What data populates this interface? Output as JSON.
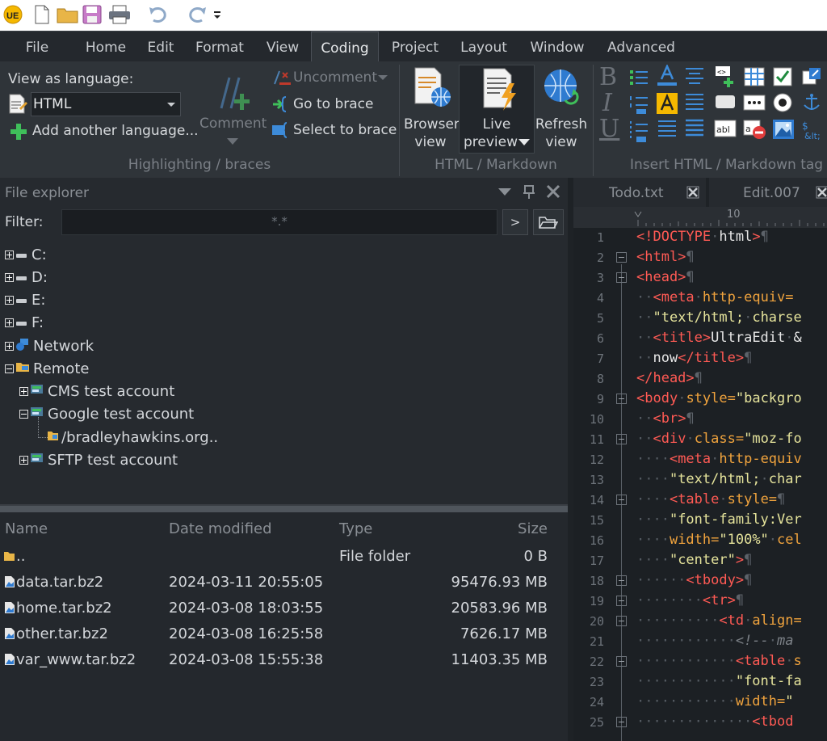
{
  "menu": {
    "tabs": [
      "File",
      "Home",
      "Edit",
      "Format",
      "View",
      "Coding",
      "Project",
      "Layout",
      "Window",
      "Advanced"
    ],
    "active": "Coding"
  },
  "ribbon": {
    "view_as_language_label": "View as language:",
    "language_value": "HTML",
    "add_language": "Add another language...",
    "comment": "Comment",
    "uncomment": "Uncomment",
    "go_to_brace": "Go to brace",
    "select_to_brace": "Select to brace",
    "group_highlighting": "Highlighting / braces",
    "browser_view": [
      "Browser",
      "view"
    ],
    "live_preview": [
      "Live",
      "preview"
    ],
    "refresh_view": [
      "Refresh",
      "view"
    ],
    "group_html": "HTML / Markdown",
    "format_letters": [
      "B",
      "I",
      "U"
    ],
    "group_insert": "Insert HTML / Markdown tag"
  },
  "explorer": {
    "title": "File explorer",
    "filter_label": "Filter:",
    "filter_value": "*.*",
    "go_button": ">",
    "tree": [
      {
        "label": "C:"
      },
      {
        "label": "D:"
      },
      {
        "label": "E:"
      },
      {
        "label": "F:"
      },
      {
        "label": "Network"
      },
      {
        "label": "Remote"
      },
      {
        "label": "CMS test account"
      },
      {
        "label": "Google test account"
      },
      {
        "label": "/bradleyhawkins.org.."
      },
      {
        "label": "SFTP test account"
      }
    ]
  },
  "files": {
    "columns": {
      "name": "Name",
      "date": "Date modified",
      "type": "Type",
      "size": "Size"
    },
    "rows": [
      {
        "name": "..",
        "date": "",
        "type": "File folder",
        "size": "0 B"
      },
      {
        "name": "data.tar.bz2",
        "date": "2024-03-11 20:55:05",
        "type": "",
        "size": "95476.93 MB"
      },
      {
        "name": "home.tar.bz2",
        "date": "2024-03-08 18:03:55",
        "type": "",
        "size": "20583.96 MB"
      },
      {
        "name": "other.tar.bz2",
        "date": "2024-03-08 16:25:58",
        "type": "",
        "size": "7626.17 MB"
      },
      {
        "name": "var_www.tar.bz2",
        "date": "2024-03-08 15:55:38",
        "type": "",
        "size": "11403.35 MB"
      }
    ]
  },
  "editor": {
    "tabs": [
      "Todo.txt",
      "Edit.007"
    ],
    "ruler_label": "10",
    "line_numbers": [
      "1",
      "2",
      "3",
      "4",
      "5",
      "6",
      "7",
      "8",
      "9",
      "10",
      "11",
      "12",
      "13",
      "14",
      "15",
      "16",
      "17",
      "18",
      "19",
      "20",
      "21",
      "22",
      "23",
      "24",
      "25"
    ]
  },
  "colors": {
    "accent": "#2f3439",
    "tag": "#ff5a54",
    "attribute": "#f0a33d",
    "string": "#e5e39b"
  }
}
